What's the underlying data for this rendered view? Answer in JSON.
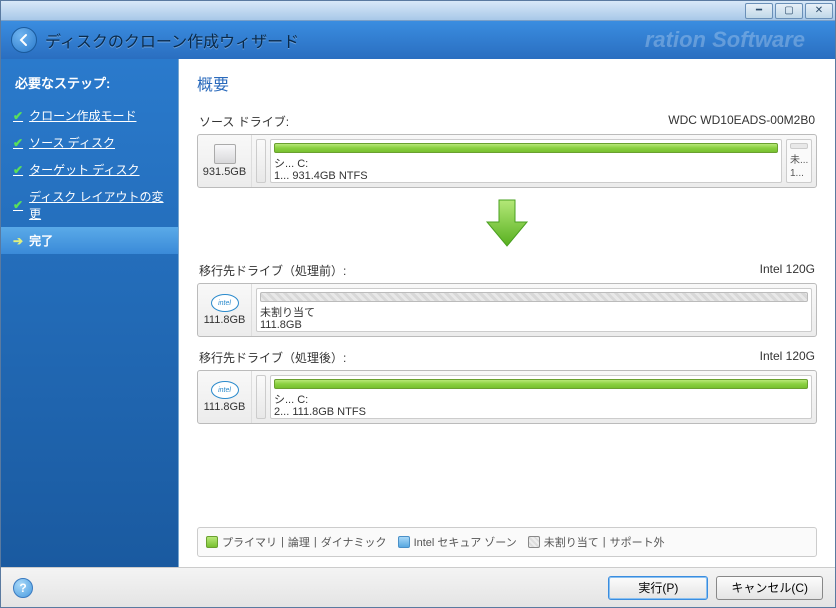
{
  "window": {
    "bg_title": "ration Software"
  },
  "header": {
    "title": "ディスクのクローン作成ウィザード"
  },
  "sidebar": {
    "title": "必要なステップ:",
    "steps": [
      {
        "label": "クローン作成モード"
      },
      {
        "label": "ソース ディスク"
      },
      {
        "label": "ターゲット ディスク"
      },
      {
        "label": "ディスク レイアウトの変更"
      }
    ],
    "current": "完了"
  },
  "main": {
    "title": "概要",
    "source": {
      "heading": "ソース ドライブ:",
      "device": "WDC WD10EADS-00M2B0",
      "size": "931.5GB",
      "part_line1": "シ... C:",
      "part_line2": "1... 931.4GB  NTFS",
      "right_line1": "未...",
      "right_line2": "1..."
    },
    "before": {
      "heading": "移行先ドライブ（処理前）:",
      "device": "Intel 120G",
      "size": "111.8GB",
      "badge": "intel",
      "part_line1": "未割り当て",
      "part_line2": "111.8GB"
    },
    "after": {
      "heading": "移行先ドライブ（処理後）:",
      "device": "Intel 120G",
      "size": "111.8GB",
      "badge": "intel",
      "part_line1": "シ... C:",
      "part_line2": "2... 111.8GB  NTFS"
    },
    "legend": {
      "primary": "プライマリ",
      "logical": "論理",
      "dynamic": "ダイナミック",
      "intel": "Intel セキュア ゾーン",
      "unalloc": "未割り当て",
      "unsupported": "サポート外"
    }
  },
  "footer": {
    "execute": "実行(P)",
    "cancel": "キャンセル(C)"
  }
}
